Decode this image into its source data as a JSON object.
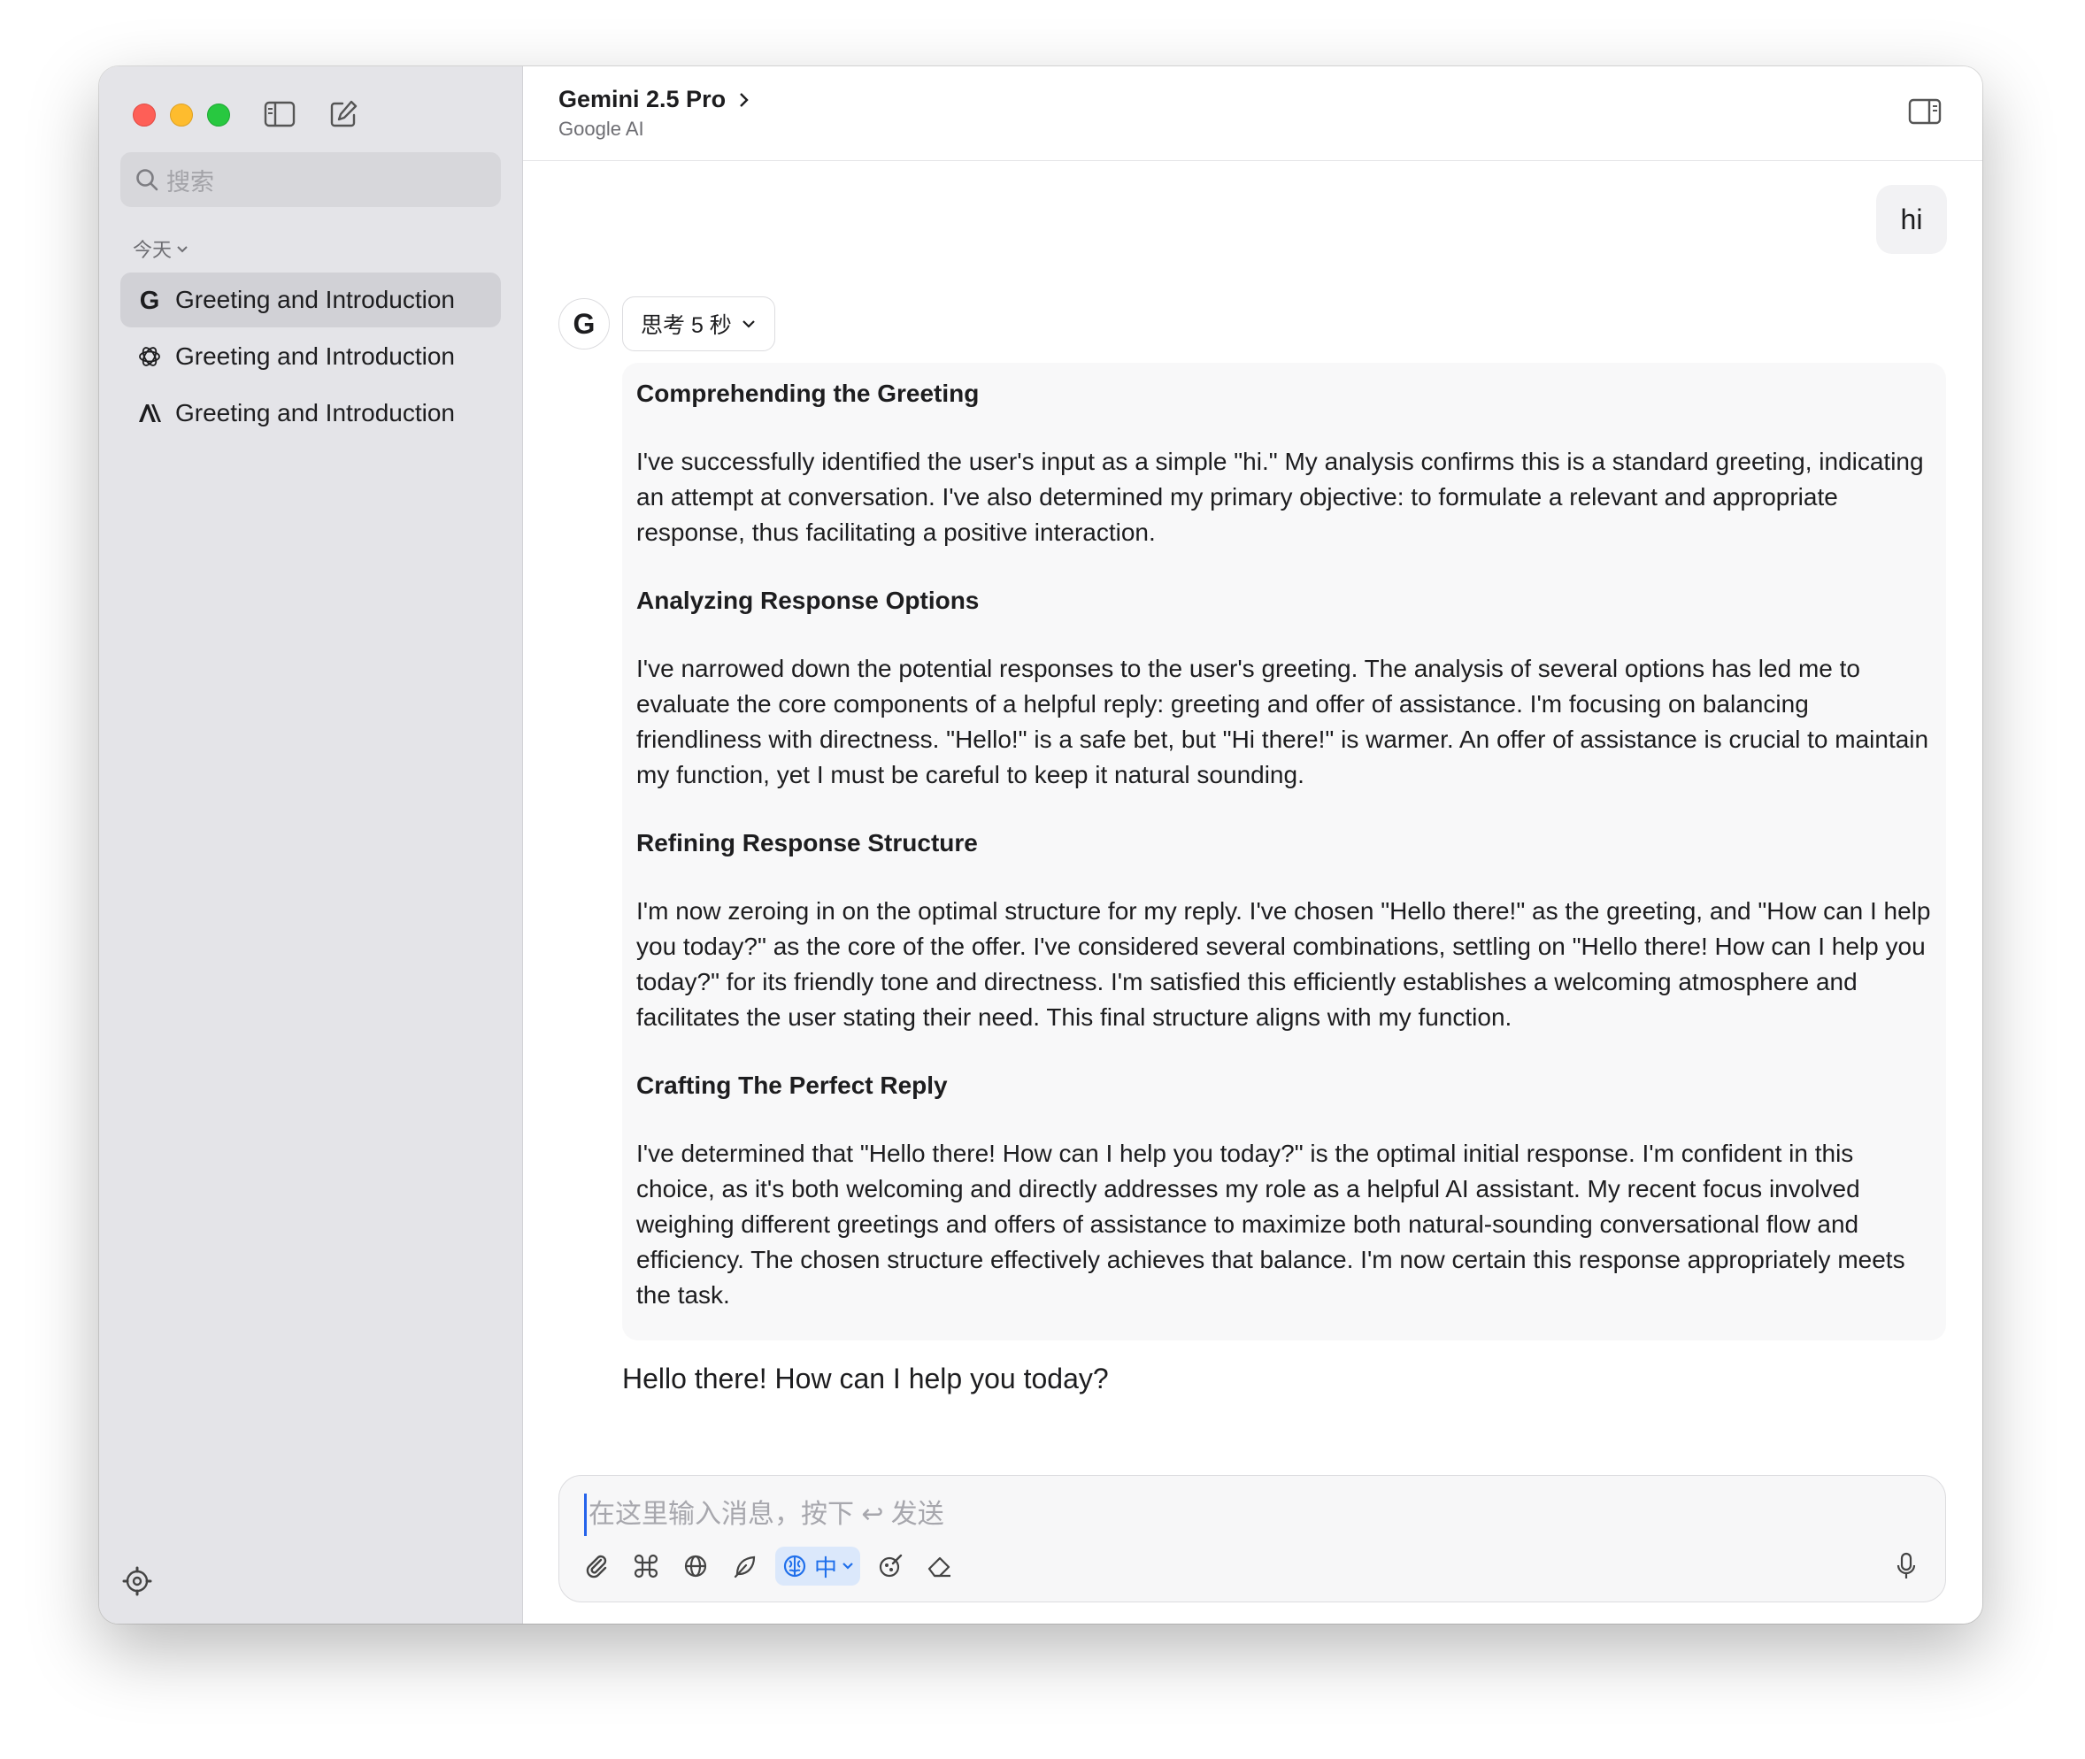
{
  "sidebar": {
    "search": {
      "placeholder": "搜索"
    },
    "section_label": "今天",
    "items": [
      {
        "label": "Greeting and Introduction",
        "icon": "google-g-icon",
        "active": true
      },
      {
        "label": "Greeting and Introduction",
        "icon": "openai-icon",
        "active": false
      },
      {
        "label": "Greeting and Introduction",
        "icon": "anthropic-icon",
        "active": false
      }
    ]
  },
  "header": {
    "model": "Gemini 2.5 Pro",
    "provider": "Google AI"
  },
  "conversation": {
    "user_message": "hi",
    "thinking_label": "思考 5 秒",
    "thinking_sections": [
      {
        "title": "Comprehending the Greeting",
        "body": "I've successfully identified the user's input as a simple \"hi.\" My analysis confirms this is a standard greeting, indicating an attempt at conversation. I've also determined my primary objective: to formulate a relevant and appropriate response, thus facilitating a positive interaction."
      },
      {
        "title": "Analyzing Response Options",
        "body": "I've narrowed down the potential responses to the user's greeting. The analysis of several options has led me to evaluate the core components of a helpful reply: greeting and offer of assistance. I'm focusing on balancing friendliness with directness. \"Hello!\" is a safe bet, but \"Hi there!\" is warmer. An offer of assistance is crucial to maintain my function, yet I must be careful to keep it natural sounding."
      },
      {
        "title": "Refining Response Structure",
        "body": "I'm now zeroing in on the optimal structure for my reply. I've chosen \"Hello there!\" as the greeting, and \"How can I help you today?\" as the core of the offer. I've considered several combinations, settling on \"Hello there! How can I help you today?\" for its friendly tone and directness. I'm satisfied this efficiently establishes a welcoming atmosphere and facilitates the user stating their need. This final structure aligns with my function."
      },
      {
        "title": "Crafting The Perfect Reply",
        "body": "I've determined that \"Hello there! How can I help you today?\" is the optimal initial response. I'm confident in this choice, as it's both welcoming and directly addresses my role as a helpful AI assistant. My recent focus involved weighing different greetings and offers of assistance to maximize both natural-sounding conversational flow and efficiency. The chosen structure effectively achieves that balance. I'm now certain this response appropriately meets the task."
      }
    ],
    "assistant_reply": "Hello there! How can I help you today?"
  },
  "composer": {
    "placeholder": "在这里输入消息，按下 ↩ 发送",
    "value": "",
    "language_label": "中"
  },
  "colors": {
    "accent": "#1f6feb",
    "sidebar_bg": "#e4e4e8",
    "active_item_bg": "#d1d1d6"
  }
}
